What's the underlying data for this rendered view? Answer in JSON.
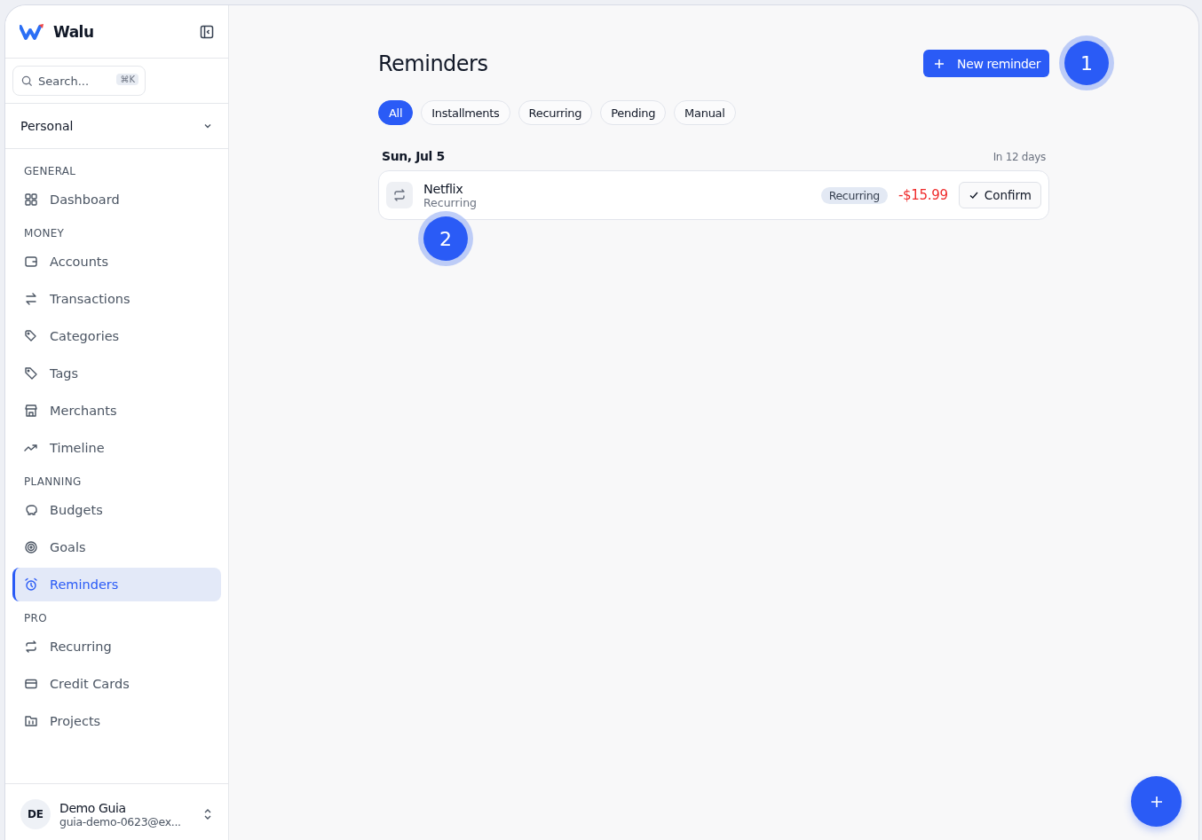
{
  "sidebar": {
    "brand": "Walu",
    "search": {
      "placeholder": "Search...",
      "shortcut": "⌘K"
    },
    "workspace": "Personal",
    "sections": [
      {
        "label": "GENERAL",
        "items": [
          {
            "label": "Dashboard",
            "selected": false
          }
        ]
      },
      {
        "label": "MONEY",
        "items": [
          {
            "label": "Accounts",
            "selected": false
          },
          {
            "label": "Transactions",
            "selected": false
          },
          {
            "label": "Categories",
            "selected": false
          },
          {
            "label": "Tags",
            "selected": false
          },
          {
            "label": "Merchants",
            "selected": false
          },
          {
            "label": "Timeline",
            "selected": false
          }
        ]
      },
      {
        "label": "PLANNING",
        "items": [
          {
            "label": "Budgets",
            "selected": false
          },
          {
            "label": "Goals",
            "selected": false
          },
          {
            "label": "Reminders",
            "selected": true
          }
        ]
      },
      {
        "label": "PRO",
        "items": [
          {
            "label": "Recurring",
            "selected": false
          },
          {
            "label": "Credit Cards",
            "selected": false
          },
          {
            "label": "Projects",
            "selected": false
          }
        ]
      }
    ],
    "user": {
      "initials": "DE",
      "name": "Demo Guia",
      "email": "guia-demo-0623@ex..."
    }
  },
  "page": {
    "title": "Reminders",
    "new_button": "New reminder",
    "filters": [
      {
        "label": "All",
        "selected": true
      },
      {
        "label": "Installments",
        "selected": false
      },
      {
        "label": "Recurring",
        "selected": false
      },
      {
        "label": "Pending",
        "selected": false
      },
      {
        "label": "Manual",
        "selected": false
      }
    ],
    "groups": [
      {
        "date": "Sun, Jul 5",
        "relative": "In 12 days",
        "reminders": [
          {
            "name": "Netflix",
            "subtitle": "Recurring",
            "tag": "Recurring",
            "amount": "-$15.99",
            "action": "Confirm"
          }
        ]
      }
    ]
  },
  "callouts": [
    {
      "number": "1"
    },
    {
      "number": "2"
    }
  ]
}
